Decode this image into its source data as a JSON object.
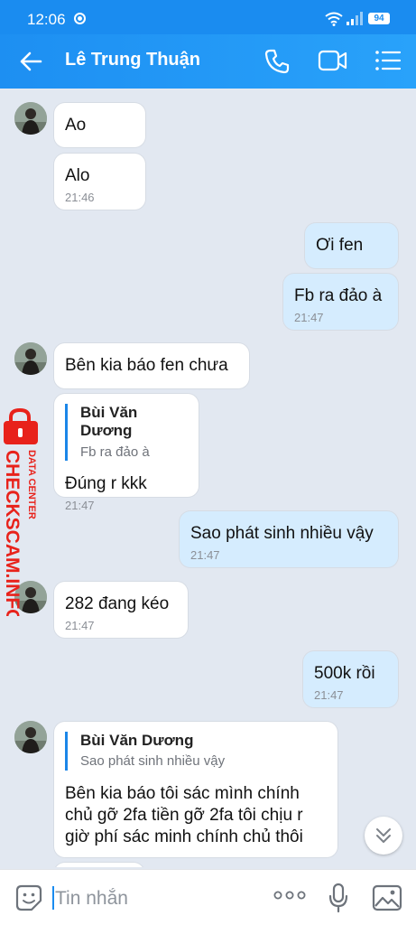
{
  "status_bar": {
    "time": "12:06",
    "battery": "94"
  },
  "header": {
    "contact_name": "Lê Trung Thuận"
  },
  "messages": [
    {
      "text": "Ao"
    },
    {
      "text": "Alo",
      "time": "21:46"
    },
    {
      "text": "Ơi fen"
    },
    {
      "text": "Fb ra đảo à",
      "time": "21:47"
    },
    {
      "text": "Bên kia báo fen chưa"
    },
    {
      "quote_name": "Bùi Văn Dương",
      "quote_text": "Fb ra đảo à",
      "text": "Đúng r kkk",
      "time": "21:47"
    },
    {
      "text": "Sao phát sinh nhiều vậy",
      "time": "21:47"
    },
    {
      "text": "282 đang kéo",
      "time": "21:47"
    },
    {
      "text": "500k rồi",
      "time": "21:47"
    },
    {
      "quote_name": "Bùi Văn Dương",
      "quote_text": "Sao phát sinh nhiều vậy",
      "text": "Bên kia báo tôi sác mình chính chủ gỡ 2fa tiền gỡ 2fa tôi chịu r giờ phí sác minh chính chủ thôi"
    }
  ],
  "watermark": {
    "line1": "DATA CENTER",
    "line2": "CHECKSCAM.INFO",
    "color": "#e8221b"
  },
  "input": {
    "placeholder": "Tin nhắn"
  },
  "colors": {
    "header": "#1d8ff2",
    "incoming": "#ffffff",
    "outgoing": "#d5ecfe",
    "background": "#e2e8f1"
  }
}
